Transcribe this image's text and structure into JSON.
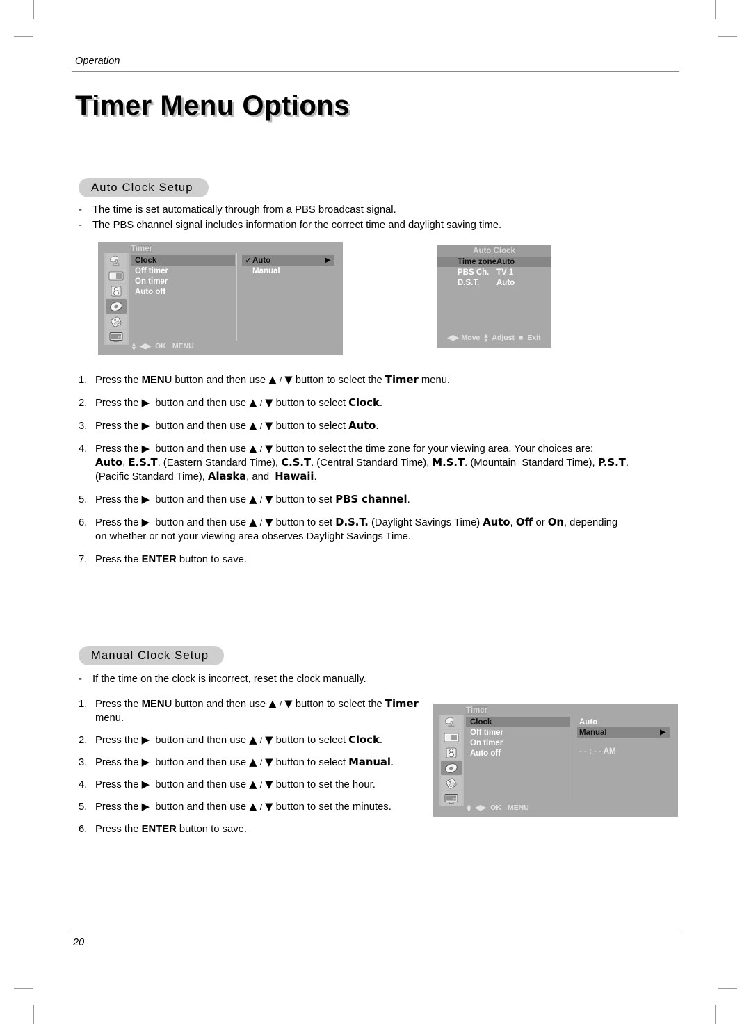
{
  "running_head": "Operation",
  "page_title": "Timer Menu Options",
  "page_number": "20",
  "sections": {
    "auto": {
      "pill_label": "Auto Clock Setup",
      "dashes": [
        "The time is set automatically through from a PBS broadcast signal.",
        "The PBS channel signal includes information for the correct time and daylight saving time."
      ],
      "steps": [
        {
          "num": "1.",
          "html": "Press the <b>MENU</b> button and then use <span class=\"heavy\">▲</span> <span class=\"arr\">/</span> <span class=\"heavy\">▼</span> button to select the <b class=\"heavy\">Timer</b> menu."
        },
        {
          "num": "2.",
          "html": "Press the <span class=\"heavy\">▶</span>&nbsp; button and then use <span class=\"heavy\">▲</span> <span class=\"arr\">/</span> <span class=\"heavy\">▼</span> button to select <b class=\"heavy\">Clock</b>."
        },
        {
          "num": "3.",
          "html": "Press the <span class=\"heavy\">▶</span>&nbsp; button and then use <span class=\"heavy\">▲</span> <span class=\"arr\">/</span> <span class=\"heavy\">▼</span> button to select <b class=\"heavy\">Auto</b>."
        },
        {
          "num": "4.",
          "html": "Press the <span class=\"heavy\">▶</span>&nbsp; button and then use <span class=\"heavy\">▲</span> <span class=\"arr\">/</span> <span class=\"heavy\">▼</span> button to select the time zone for your viewing area. Your choices are:<br><b class=\"heavy\">Auto</b>, <b class=\"heavy\">E.S.T</b>. (Eastern Standard Time), <b class=\"heavy\">C.S.T</b>. (Central Standard Time), <b class=\"heavy\">M.S.T</b>. (Mountain&nbsp; Standard Time), <b class=\"heavy\">P.S.T</b>.<br>(Pacific Standard Time), <b class=\"heavy\">Alaska</b>, and&nbsp; <b class=\"heavy\">Hawaii</b>."
        },
        {
          "num": "5.",
          "html": "Press the <span class=\"heavy\">▶</span>&nbsp; button and then use <span class=\"heavy\">▲</span> <span class=\"arr\">/</span> <span class=\"heavy\">▼</span> button to set <b class=\"heavy\">PBS channel</b>."
        },
        {
          "num": "6.",
          "html": "Press the <span class=\"heavy\">▶</span>&nbsp; button and then use <span class=\"heavy\">▲</span> <span class=\"arr\">/</span> <span class=\"heavy\">▼</span> button to set <b class=\"heavy\">D.S.T.</b> (Daylight Savings Time) <b class=\"heavy\">Auto</b>, <b class=\"heavy\">Off</b> or <b class=\"heavy\">On</b>, depending<br>on whether or not your viewing area observes Daylight Savings Time."
        },
        {
          "num": "7.",
          "html": "Press the <b>ENTER</b> button to save."
        }
      ]
    },
    "manual": {
      "pill_label": "Manual Clock Setup",
      "dashes": [
        "If the time on the clock is incorrect, reset the clock manually."
      ],
      "steps": [
        {
          "num": "1.",
          "html": "Press the <b>MENU</b> button and then use <span class=\"heavy\">▲</span> <span class=\"arr\">/</span> <span class=\"heavy\">▼</span> button to select the <b class=\"heavy\">Timer</b><br>menu."
        },
        {
          "num": "2.",
          "html": "Press the <span class=\"heavy\">▶</span>&nbsp; button and then use <span class=\"heavy\">▲</span> <span class=\"arr\">/</span> <span class=\"heavy\">▼</span> button to select <b class=\"heavy\">Clock</b>."
        },
        {
          "num": "3.",
          "html": "Press the <span class=\"heavy\">▶</span>&nbsp; button and then use <span class=\"heavy\">▲</span> <span class=\"arr\">/</span> <span class=\"heavy\">▼</span> button to select <b class=\"heavy\">Manual</b>."
        },
        {
          "num": "4.",
          "html": "Press the <span class=\"heavy\">▶</span>&nbsp; button and then use <span class=\"heavy\">▲</span> <span class=\"arr\">/</span> <span class=\"heavy\">▼</span> button to set the hour."
        },
        {
          "num": "5.",
          "html": "Press the <span class=\"heavy\">▶</span>&nbsp; button and then use <span class=\"heavy\">▲</span> <span class=\"arr\">/</span> <span class=\"heavy\">▼</span> button to set the minutes."
        },
        {
          "num": "6.",
          "html": "Press the <b>ENTER</b> button to save."
        }
      ]
    }
  },
  "osd_auto": {
    "title": "Timer",
    "rail_icons": [
      "antenna-icon",
      "picture-icon",
      "sound-icon",
      "timer-icon",
      "special-icon",
      "pc-icon"
    ],
    "rail_selected_index": 3,
    "menu_items": [
      {
        "label": "Clock",
        "highlighted": true
      },
      {
        "label": "Off timer",
        "highlighted": false
      },
      {
        "label": "On timer",
        "highlighted": false
      },
      {
        "label": "Auto off",
        "highlighted": false
      }
    ],
    "options": [
      {
        "label": "Auto",
        "checked": true,
        "highlighted": true,
        "pointer": "▶"
      },
      {
        "label": "Manual",
        "checked": false,
        "highlighted": false,
        "pointer": ""
      }
    ],
    "footer": {
      "move": "◀▶",
      "ok": "OK",
      "menu": "MENU"
    }
  },
  "osd_auto_clock": {
    "title": "Auto Clock",
    "rows": [
      {
        "key": "Time zone",
        "value": "Auto",
        "highlighted": true
      },
      {
        "key": "PBS Ch.",
        "value": "TV 1",
        "highlighted": false
      },
      {
        "key": "D.S.T.",
        "value": "Auto",
        "highlighted": false
      }
    ],
    "footer": "◀▶ Move ▲▼ Adjust  ■  Exit",
    "footer_parts": {
      "move": "Move",
      "adjust": "Adjust",
      "exit": "Exit"
    }
  },
  "osd_manual": {
    "title": "Timer",
    "rail_icons": [
      "antenna-icon",
      "picture-icon",
      "sound-icon",
      "timer-icon",
      "special-icon",
      "pc-icon"
    ],
    "rail_selected_index": 3,
    "menu_items": [
      {
        "label": "Clock",
        "highlighted": true
      },
      {
        "label": "Off timer",
        "highlighted": false
      },
      {
        "label": "On timer",
        "highlighted": false
      },
      {
        "label": "Auto off",
        "highlighted": false
      }
    ],
    "options": [
      {
        "label": "Auto",
        "highlighted": false,
        "pointer": ""
      },
      {
        "label": "Manual",
        "highlighted": true,
        "pointer": "▶"
      }
    ],
    "time_value": "- - : - -   AM",
    "footer": {
      "move": "◀▶",
      "ok": "OK",
      "menu": "MENU"
    }
  },
  "colors": {
    "osd_background": "#a8a8a8",
    "osd_titlebar": "#9c9c9c",
    "osd_highlight": "#868686",
    "osd_rail": "#bcbcbc",
    "pill_background": "#cfcfcf",
    "rule": "#8c8c8c"
  }
}
